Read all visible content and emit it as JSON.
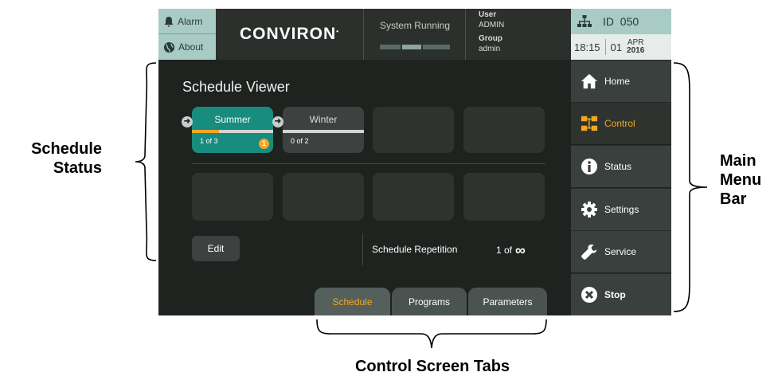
{
  "topbar": {
    "alarm_label": "Alarm",
    "about_label": "About",
    "logo_text": "CONVIRON",
    "status_text": "System Running",
    "user_heading": "User",
    "user_value": "ADMIN",
    "group_heading": "Group",
    "group_value": "admin",
    "id_label": "ID",
    "id_value": "050",
    "time": "18:15",
    "day": "01",
    "month": "APR",
    "year": "2016"
  },
  "schedule": {
    "title": "Schedule Viewer",
    "tiles": [
      {
        "name": "Summer",
        "count": "1 of 3",
        "badge": "1",
        "progress": 0.33
      },
      {
        "name": "Winter",
        "count": "0 of 2",
        "progress": 0
      }
    ],
    "edit_label": "Edit",
    "repetition_label": "Schedule Repetition",
    "repetition_value": "1  of",
    "repetition_max": "∞"
  },
  "tabs": [
    {
      "label": "Schedule",
      "active": true
    },
    {
      "label": "Programs"
    },
    {
      "label": "Parameters"
    }
  ],
  "menu": [
    {
      "label": "Home",
      "icon": "home-icon"
    },
    {
      "label": "Control",
      "icon": "control-icon",
      "active": true
    },
    {
      "label": "Status",
      "icon": "info-icon"
    },
    {
      "label": "Settings",
      "icon": "gear-icon"
    },
    {
      "label": "Service",
      "icon": "wrench-icon"
    },
    {
      "label": "Stop",
      "icon": "stop-icon"
    }
  ],
  "annotations": {
    "schedule_status_1": "Schedule",
    "schedule_status_2": "Status",
    "main_menu_1": "Main",
    "main_menu_2": "Menu",
    "main_menu_3": "Bar",
    "tabs": "Control Screen Tabs"
  },
  "colors": {
    "accent": "#f5a623",
    "teal": "#178c7f",
    "panel": "#1e2320"
  }
}
